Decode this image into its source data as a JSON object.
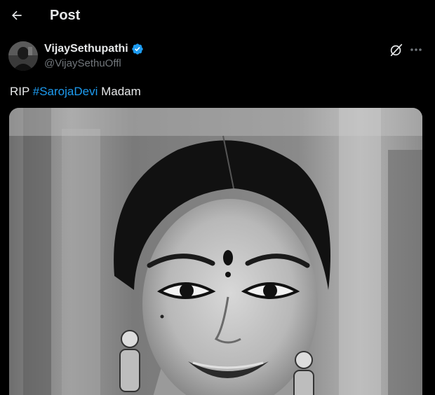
{
  "header": {
    "title": "Post",
    "back_icon": "arrow-left-icon"
  },
  "author": {
    "name": "VijaySethupathi",
    "handle": "@VijaySethuOffl",
    "verified": true,
    "verified_color": "#1d9bf0"
  },
  "tweet": {
    "text_before": "RIP ",
    "hashtag": "#SarojaDevi",
    "text_after": " Madam",
    "hashtag_color": "#1d9bf0"
  },
  "actions": {
    "grok_icon": "grok-icon",
    "more_icon": "more-horizontal-icon"
  },
  "media": {
    "kind": "black-and-white portrait photo"
  }
}
